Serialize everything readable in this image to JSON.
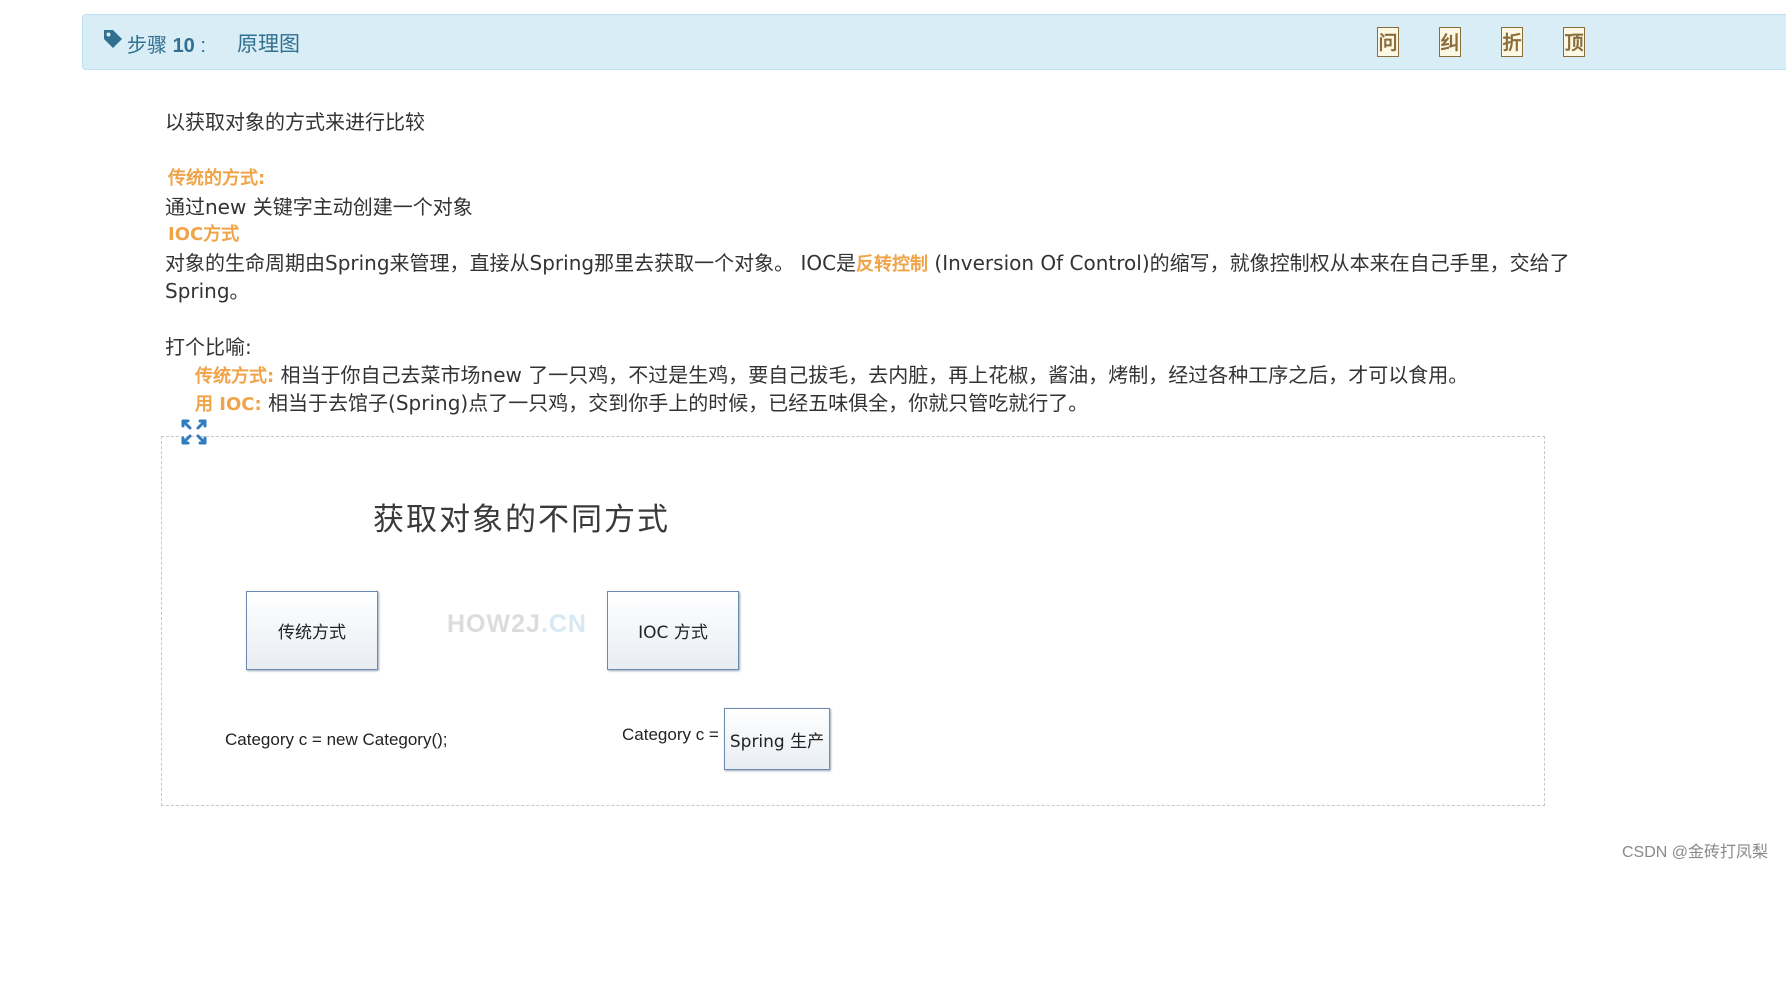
{
  "header": {
    "step_prefix": "步骤",
    "step_number": "10",
    "step_colon": ":",
    "title": "原理图",
    "buttons": [
      "问",
      "纠",
      "折",
      "顶"
    ]
  },
  "content": {
    "intro": "以获取对象的方式来进行比较",
    "traditional_heading": "传统的方式:",
    "traditional_desc": "通过new 关键字主动创建一个对象",
    "ioc_heading": "IOC方式",
    "ioc_desc_part1": "对象的生命周期由Spring来管理，直接从Spring那里去获取一个对象。 IOC是",
    "ioc_highlight": "反转控制",
    "ioc_desc_part2": " (Inversion Of Control)的缩写，就像控制权从本来在自己手里，交给了",
    "ioc_desc_part3": "Spring。",
    "analogy_heading": "打个比喻:",
    "analogy_trad_label": "传统方式:",
    "analogy_trad_text": " 相当于你自己去菜市场new 了一只鸡，不过是生鸡，要自己拔毛，去内脏，再上花椒，酱油，烤制，经过各种工序之后，才可以食用。",
    "analogy_ioc_label": "用 IOC:",
    "analogy_ioc_text": " 相当于去馆子(Spring)点了一只鸡，交到你手上的时候，已经五味俱全，你就只管吃就行了。"
  },
  "diagram": {
    "title": "获取对象的不同方式",
    "node_traditional": "传统方式",
    "node_ioc": "IOC 方式",
    "code_traditional": "Category c = new Category();",
    "code_ioc_prefix": "Category c =",
    "node_spring": "Spring 生产",
    "watermark_main": "HOW2J",
    "watermark_suffix": ".CN"
  },
  "footer": {
    "csdn": "CSDN @金砖打凤梨"
  }
}
